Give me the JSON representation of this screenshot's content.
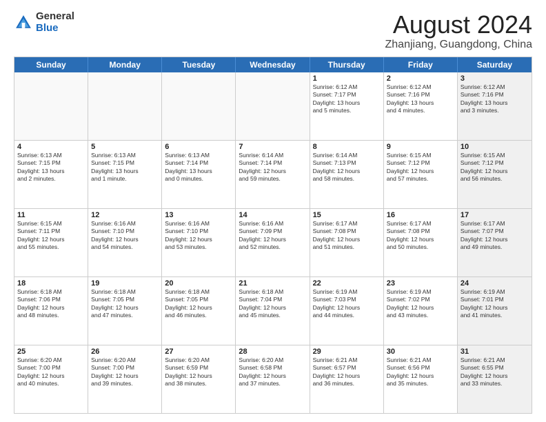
{
  "logo": {
    "general": "General",
    "blue": "Blue"
  },
  "header": {
    "month_year": "August 2024",
    "location": "Zhanjiang, Guangdong, China"
  },
  "days": [
    "Sunday",
    "Monday",
    "Tuesday",
    "Wednesday",
    "Thursday",
    "Friday",
    "Saturday"
  ],
  "weeks": [
    [
      {
        "day": "",
        "text": "",
        "empty": true
      },
      {
        "day": "",
        "text": "",
        "empty": true
      },
      {
        "day": "",
        "text": "",
        "empty": true
      },
      {
        "day": "",
        "text": "",
        "empty": true
      },
      {
        "day": "1",
        "text": "Sunrise: 6:12 AM\nSunset: 7:17 PM\nDaylight: 13 hours\nand 5 minutes.",
        "empty": false
      },
      {
        "day": "2",
        "text": "Sunrise: 6:12 AM\nSunset: 7:16 PM\nDaylight: 13 hours\nand 4 minutes.",
        "empty": false
      },
      {
        "day": "3",
        "text": "Sunrise: 6:12 AM\nSunset: 7:16 PM\nDaylight: 13 hours\nand 3 minutes.",
        "empty": false,
        "shaded": true
      }
    ],
    [
      {
        "day": "4",
        "text": "Sunrise: 6:13 AM\nSunset: 7:15 PM\nDaylight: 13 hours\nand 2 minutes.",
        "empty": false
      },
      {
        "day": "5",
        "text": "Sunrise: 6:13 AM\nSunset: 7:15 PM\nDaylight: 13 hours\nand 1 minute.",
        "empty": false
      },
      {
        "day": "6",
        "text": "Sunrise: 6:13 AM\nSunset: 7:14 PM\nDaylight: 13 hours\nand 0 minutes.",
        "empty": false
      },
      {
        "day": "7",
        "text": "Sunrise: 6:14 AM\nSunset: 7:14 PM\nDaylight: 12 hours\nand 59 minutes.",
        "empty": false
      },
      {
        "day": "8",
        "text": "Sunrise: 6:14 AM\nSunset: 7:13 PM\nDaylight: 12 hours\nand 58 minutes.",
        "empty": false
      },
      {
        "day": "9",
        "text": "Sunrise: 6:15 AM\nSunset: 7:12 PM\nDaylight: 12 hours\nand 57 minutes.",
        "empty": false
      },
      {
        "day": "10",
        "text": "Sunrise: 6:15 AM\nSunset: 7:12 PM\nDaylight: 12 hours\nand 56 minutes.",
        "empty": false,
        "shaded": true
      }
    ],
    [
      {
        "day": "11",
        "text": "Sunrise: 6:15 AM\nSunset: 7:11 PM\nDaylight: 12 hours\nand 55 minutes.",
        "empty": false
      },
      {
        "day": "12",
        "text": "Sunrise: 6:16 AM\nSunset: 7:10 PM\nDaylight: 12 hours\nand 54 minutes.",
        "empty": false
      },
      {
        "day": "13",
        "text": "Sunrise: 6:16 AM\nSunset: 7:10 PM\nDaylight: 12 hours\nand 53 minutes.",
        "empty": false
      },
      {
        "day": "14",
        "text": "Sunrise: 6:16 AM\nSunset: 7:09 PM\nDaylight: 12 hours\nand 52 minutes.",
        "empty": false
      },
      {
        "day": "15",
        "text": "Sunrise: 6:17 AM\nSunset: 7:08 PM\nDaylight: 12 hours\nand 51 minutes.",
        "empty": false
      },
      {
        "day": "16",
        "text": "Sunrise: 6:17 AM\nSunset: 7:08 PM\nDaylight: 12 hours\nand 50 minutes.",
        "empty": false
      },
      {
        "day": "17",
        "text": "Sunrise: 6:17 AM\nSunset: 7:07 PM\nDaylight: 12 hours\nand 49 minutes.",
        "empty": false,
        "shaded": true
      }
    ],
    [
      {
        "day": "18",
        "text": "Sunrise: 6:18 AM\nSunset: 7:06 PM\nDaylight: 12 hours\nand 48 minutes.",
        "empty": false
      },
      {
        "day": "19",
        "text": "Sunrise: 6:18 AM\nSunset: 7:05 PM\nDaylight: 12 hours\nand 47 minutes.",
        "empty": false
      },
      {
        "day": "20",
        "text": "Sunrise: 6:18 AM\nSunset: 7:05 PM\nDaylight: 12 hours\nand 46 minutes.",
        "empty": false
      },
      {
        "day": "21",
        "text": "Sunrise: 6:18 AM\nSunset: 7:04 PM\nDaylight: 12 hours\nand 45 minutes.",
        "empty": false
      },
      {
        "day": "22",
        "text": "Sunrise: 6:19 AM\nSunset: 7:03 PM\nDaylight: 12 hours\nand 44 minutes.",
        "empty": false
      },
      {
        "day": "23",
        "text": "Sunrise: 6:19 AM\nSunset: 7:02 PM\nDaylight: 12 hours\nand 43 minutes.",
        "empty": false
      },
      {
        "day": "24",
        "text": "Sunrise: 6:19 AM\nSunset: 7:01 PM\nDaylight: 12 hours\nand 41 minutes.",
        "empty": false,
        "shaded": true
      }
    ],
    [
      {
        "day": "25",
        "text": "Sunrise: 6:20 AM\nSunset: 7:00 PM\nDaylight: 12 hours\nand 40 minutes.",
        "empty": false
      },
      {
        "day": "26",
        "text": "Sunrise: 6:20 AM\nSunset: 7:00 PM\nDaylight: 12 hours\nand 39 minutes.",
        "empty": false
      },
      {
        "day": "27",
        "text": "Sunrise: 6:20 AM\nSunset: 6:59 PM\nDaylight: 12 hours\nand 38 minutes.",
        "empty": false
      },
      {
        "day": "28",
        "text": "Sunrise: 6:20 AM\nSunset: 6:58 PM\nDaylight: 12 hours\nand 37 minutes.",
        "empty": false
      },
      {
        "day": "29",
        "text": "Sunrise: 6:21 AM\nSunset: 6:57 PM\nDaylight: 12 hours\nand 36 minutes.",
        "empty": false
      },
      {
        "day": "30",
        "text": "Sunrise: 6:21 AM\nSunset: 6:56 PM\nDaylight: 12 hours\nand 35 minutes.",
        "empty": false
      },
      {
        "day": "31",
        "text": "Sunrise: 6:21 AM\nSunset: 6:55 PM\nDaylight: 12 hours\nand 33 minutes.",
        "empty": false,
        "shaded": true
      }
    ]
  ]
}
